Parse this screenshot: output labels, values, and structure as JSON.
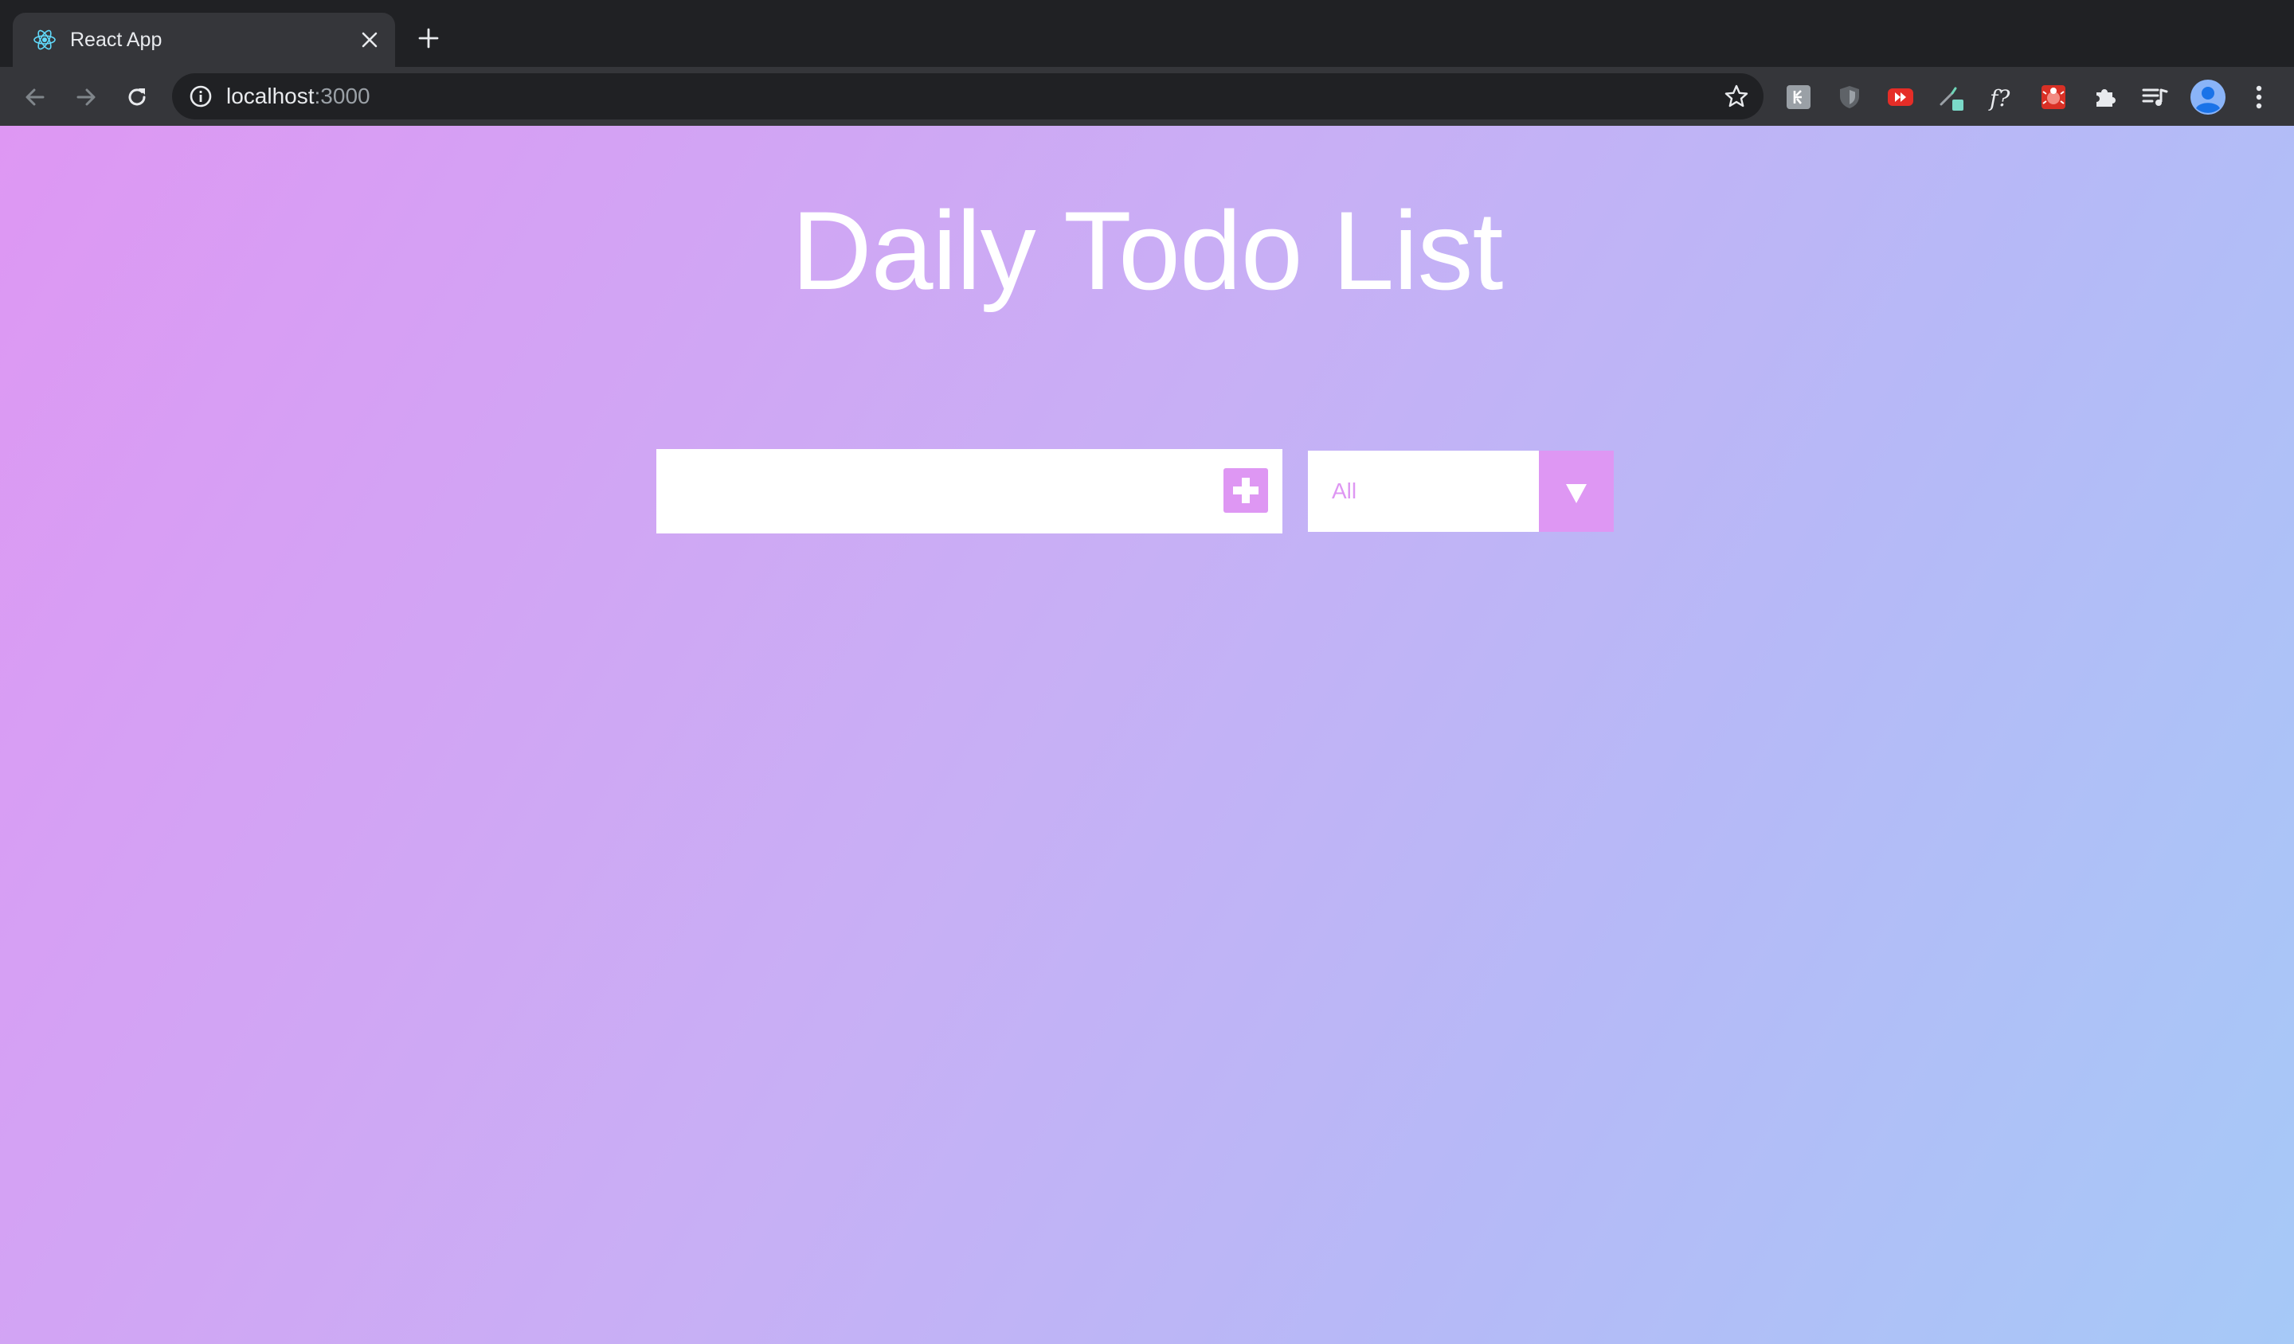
{
  "browser": {
    "tab_title": "React App",
    "url_host": "localhost",
    "url_port": ":3000",
    "colors": {
      "frame": "#202124",
      "toolbar": "#35363a"
    }
  },
  "extensions": [
    {
      "name": "grammarly-icon"
    },
    {
      "name": "shield-icon"
    },
    {
      "name": "youtube-fastforward-icon"
    },
    {
      "name": "eyedropper-icon"
    },
    {
      "name": "font-finder-icon"
    },
    {
      "name": "bug-icon"
    },
    {
      "name": "puzzle-icon"
    },
    {
      "name": "media-queue-icon"
    },
    {
      "name": "profile-avatar-icon"
    },
    {
      "name": "kebab-menu-icon"
    }
  ],
  "app": {
    "title": "Daily Todo List",
    "input": {
      "value": "",
      "placeholder": ""
    },
    "add_button_icon": "plus-square-icon",
    "filter": {
      "selected": "All"
    },
    "todos": [],
    "colors": {
      "accent": "#de97f3",
      "gradient_start": "#de97f3",
      "gradient_end": "#a6c9f7",
      "title": "#ffffff"
    }
  }
}
